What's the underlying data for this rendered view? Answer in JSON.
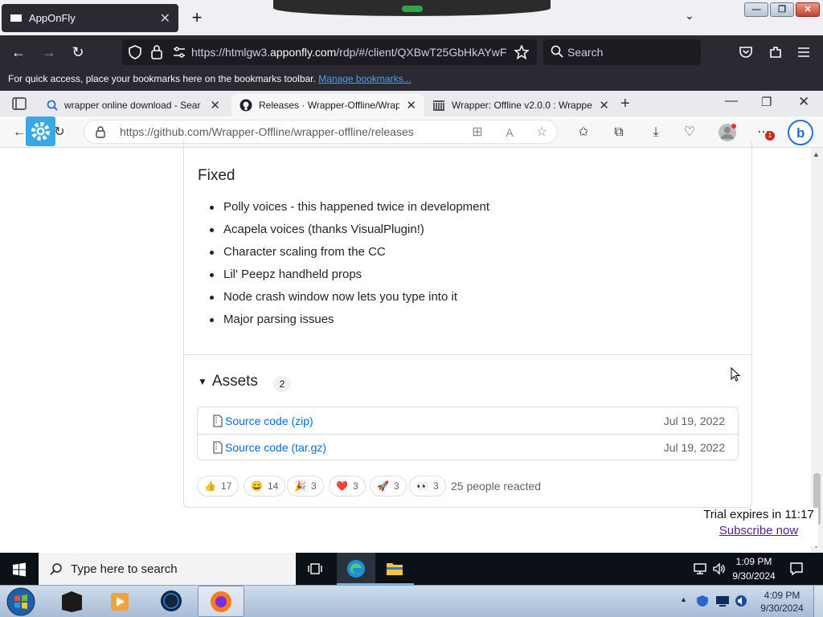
{
  "outer_browser": {
    "tab_title": "AppOnFly",
    "url_prefix": "https://htmlgw3.",
    "url_domain": "apponfly.com",
    "url_suffix": "/rdp/#/client/QXBwT25GbHkAYwF",
    "search_placeholder": "Search",
    "bookmarks_text": "For quick access, place your bookmarks here on the bookmarks toolbar.",
    "bookmarks_link": "Manage bookmarks..."
  },
  "inner_browser": {
    "tabs": [
      {
        "label": "wrapper online download - Sear",
        "icon": "search-icon"
      },
      {
        "label": "Releases · Wrapper-Offline/Wrap",
        "icon": "github-icon"
      },
      {
        "label": "Wrapper: Offline v2.0.0 : Wrappe",
        "icon": "archive-icon"
      }
    ],
    "url": "https://github.com/Wrapper-Offline/wrapper-offline/releases",
    "notification_count": "1"
  },
  "release": {
    "fixed_heading": "Fixed",
    "fixed_items": [
      "Polly voices - this happened twice in development",
      "Acapela voices (thanks VisualPlugin!)",
      "Character scaling from the CC",
      "Lil' Peepz handheld props",
      "Node crash window now lets you type into it",
      "Major parsing issues"
    ],
    "assets_heading": "Assets",
    "assets_count": "2",
    "assets": [
      {
        "name": "Source code",
        "ext": "(zip)",
        "date": "Jul 19, 2022"
      },
      {
        "name": "Source code",
        "ext": "(tar.gz)",
        "date": "Jul 19, 2022"
      }
    ],
    "reactions": [
      {
        "emoji": "👍",
        "count": "17"
      },
      {
        "emoji": "😄",
        "count": "14"
      },
      {
        "emoji": "🎉",
        "count": "3"
      },
      {
        "emoji": "❤️",
        "count": "3"
      },
      {
        "emoji": "🚀",
        "count": "3"
      },
      {
        "emoji": "👀",
        "count": "3"
      }
    ],
    "reacted_text": "25 people reacted"
  },
  "trial": {
    "text": "Trial expires in 11:17",
    "link": "Subscribe now"
  },
  "win10_taskbar": {
    "search_placeholder": "Type here to search",
    "time": "1:09 PM",
    "date": "9/30/2024"
  },
  "win7_taskbar": {
    "time": "4:09 PM",
    "date": "9/30/2024"
  }
}
